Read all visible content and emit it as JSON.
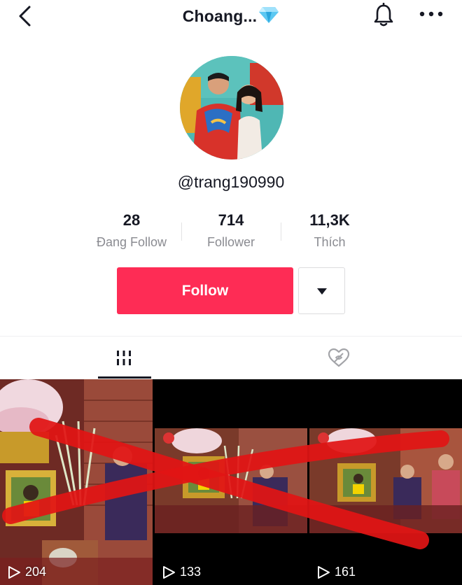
{
  "header": {
    "title": "Choang...",
    "back_icon": "chevron-left-icon",
    "title_badge_icon": "diamond-icon",
    "notification_icon": "bell-icon",
    "more_icon": "more-horizontal-icon"
  },
  "profile": {
    "username": "@trang190990",
    "avatar_icon": "profile-photo"
  },
  "stats": [
    {
      "value": "28",
      "label": "Đang Follow"
    },
    {
      "value": "714",
      "label": "Follower"
    },
    {
      "value": "11,3K",
      "label": "Thích"
    }
  ],
  "actions": {
    "follow_label": "Follow",
    "dropdown_icon": "caret-down-icon"
  },
  "tabs": {
    "videos_icon": "grid-icon",
    "liked_icon": "heart-hidden-icon"
  },
  "videos": [
    {
      "views": "204"
    },
    {
      "views": "133"
    },
    {
      "views": "161"
    }
  ],
  "colors": {
    "accent": "#fe2c55",
    "text": "#161823",
    "muted": "#8a8b91",
    "cross_mark": "#e11414"
  }
}
